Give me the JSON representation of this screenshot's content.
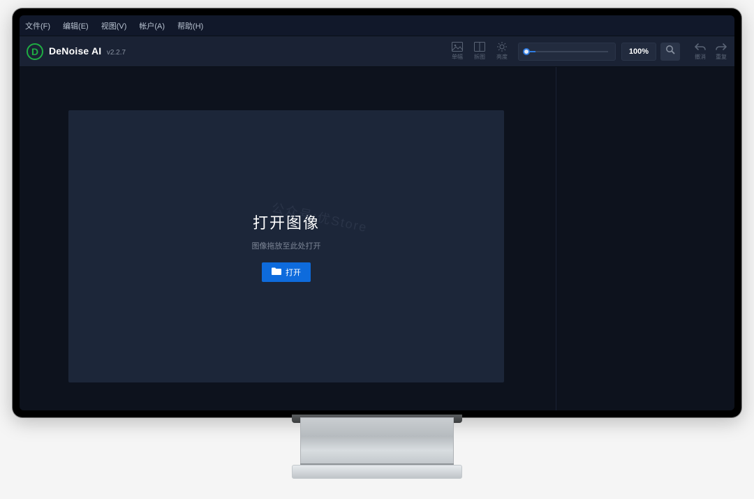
{
  "menubar": [
    {
      "label": "文件(F)"
    },
    {
      "label": "编辑(E)"
    },
    {
      "label": "视图(V)"
    },
    {
      "label": "帐户(A)"
    },
    {
      "label": "帮助(H)"
    }
  ],
  "app": {
    "logo_letter": "D",
    "title": "DeNoise AI",
    "version": "v2.2.7"
  },
  "view_buttons": [
    {
      "label": "单幅"
    },
    {
      "label": "拆图"
    },
    {
      "label": "亮度"
    }
  ],
  "zoom": {
    "value": "100%"
  },
  "history": {
    "undo_label": "撤消",
    "redo_label": "重复"
  },
  "dropzone": {
    "title": "打开图像",
    "subtitle": "图像拖放至此处打开",
    "open_label": "打开"
  },
  "watermark": "公众号:优Store"
}
